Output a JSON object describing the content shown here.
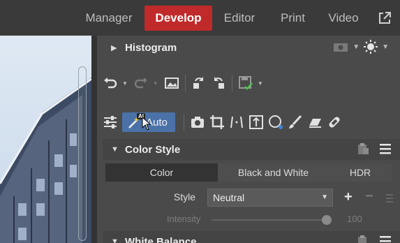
{
  "nav": {
    "items": [
      "Manager",
      "Develop",
      "Editor",
      "Print",
      "Video"
    ],
    "active": "Develop"
  },
  "histogram": {
    "title": "Histogram"
  },
  "auto": {
    "label": "Auto",
    "badge": "AI"
  },
  "color_style": {
    "title": "Color Style",
    "tabs": [
      "Color",
      "Black and White",
      "HDR"
    ],
    "active_tab": "Color",
    "style_label": "Style",
    "style_value": "Neutral",
    "plus": "+",
    "minus": "−",
    "intensity_label": "Intensity",
    "intensity_value": "100"
  },
  "white_balance": {
    "title": "White Balance"
  },
  "colors": {
    "accent_red": "#c02a2a",
    "auto_blue": "#4b72a8"
  }
}
